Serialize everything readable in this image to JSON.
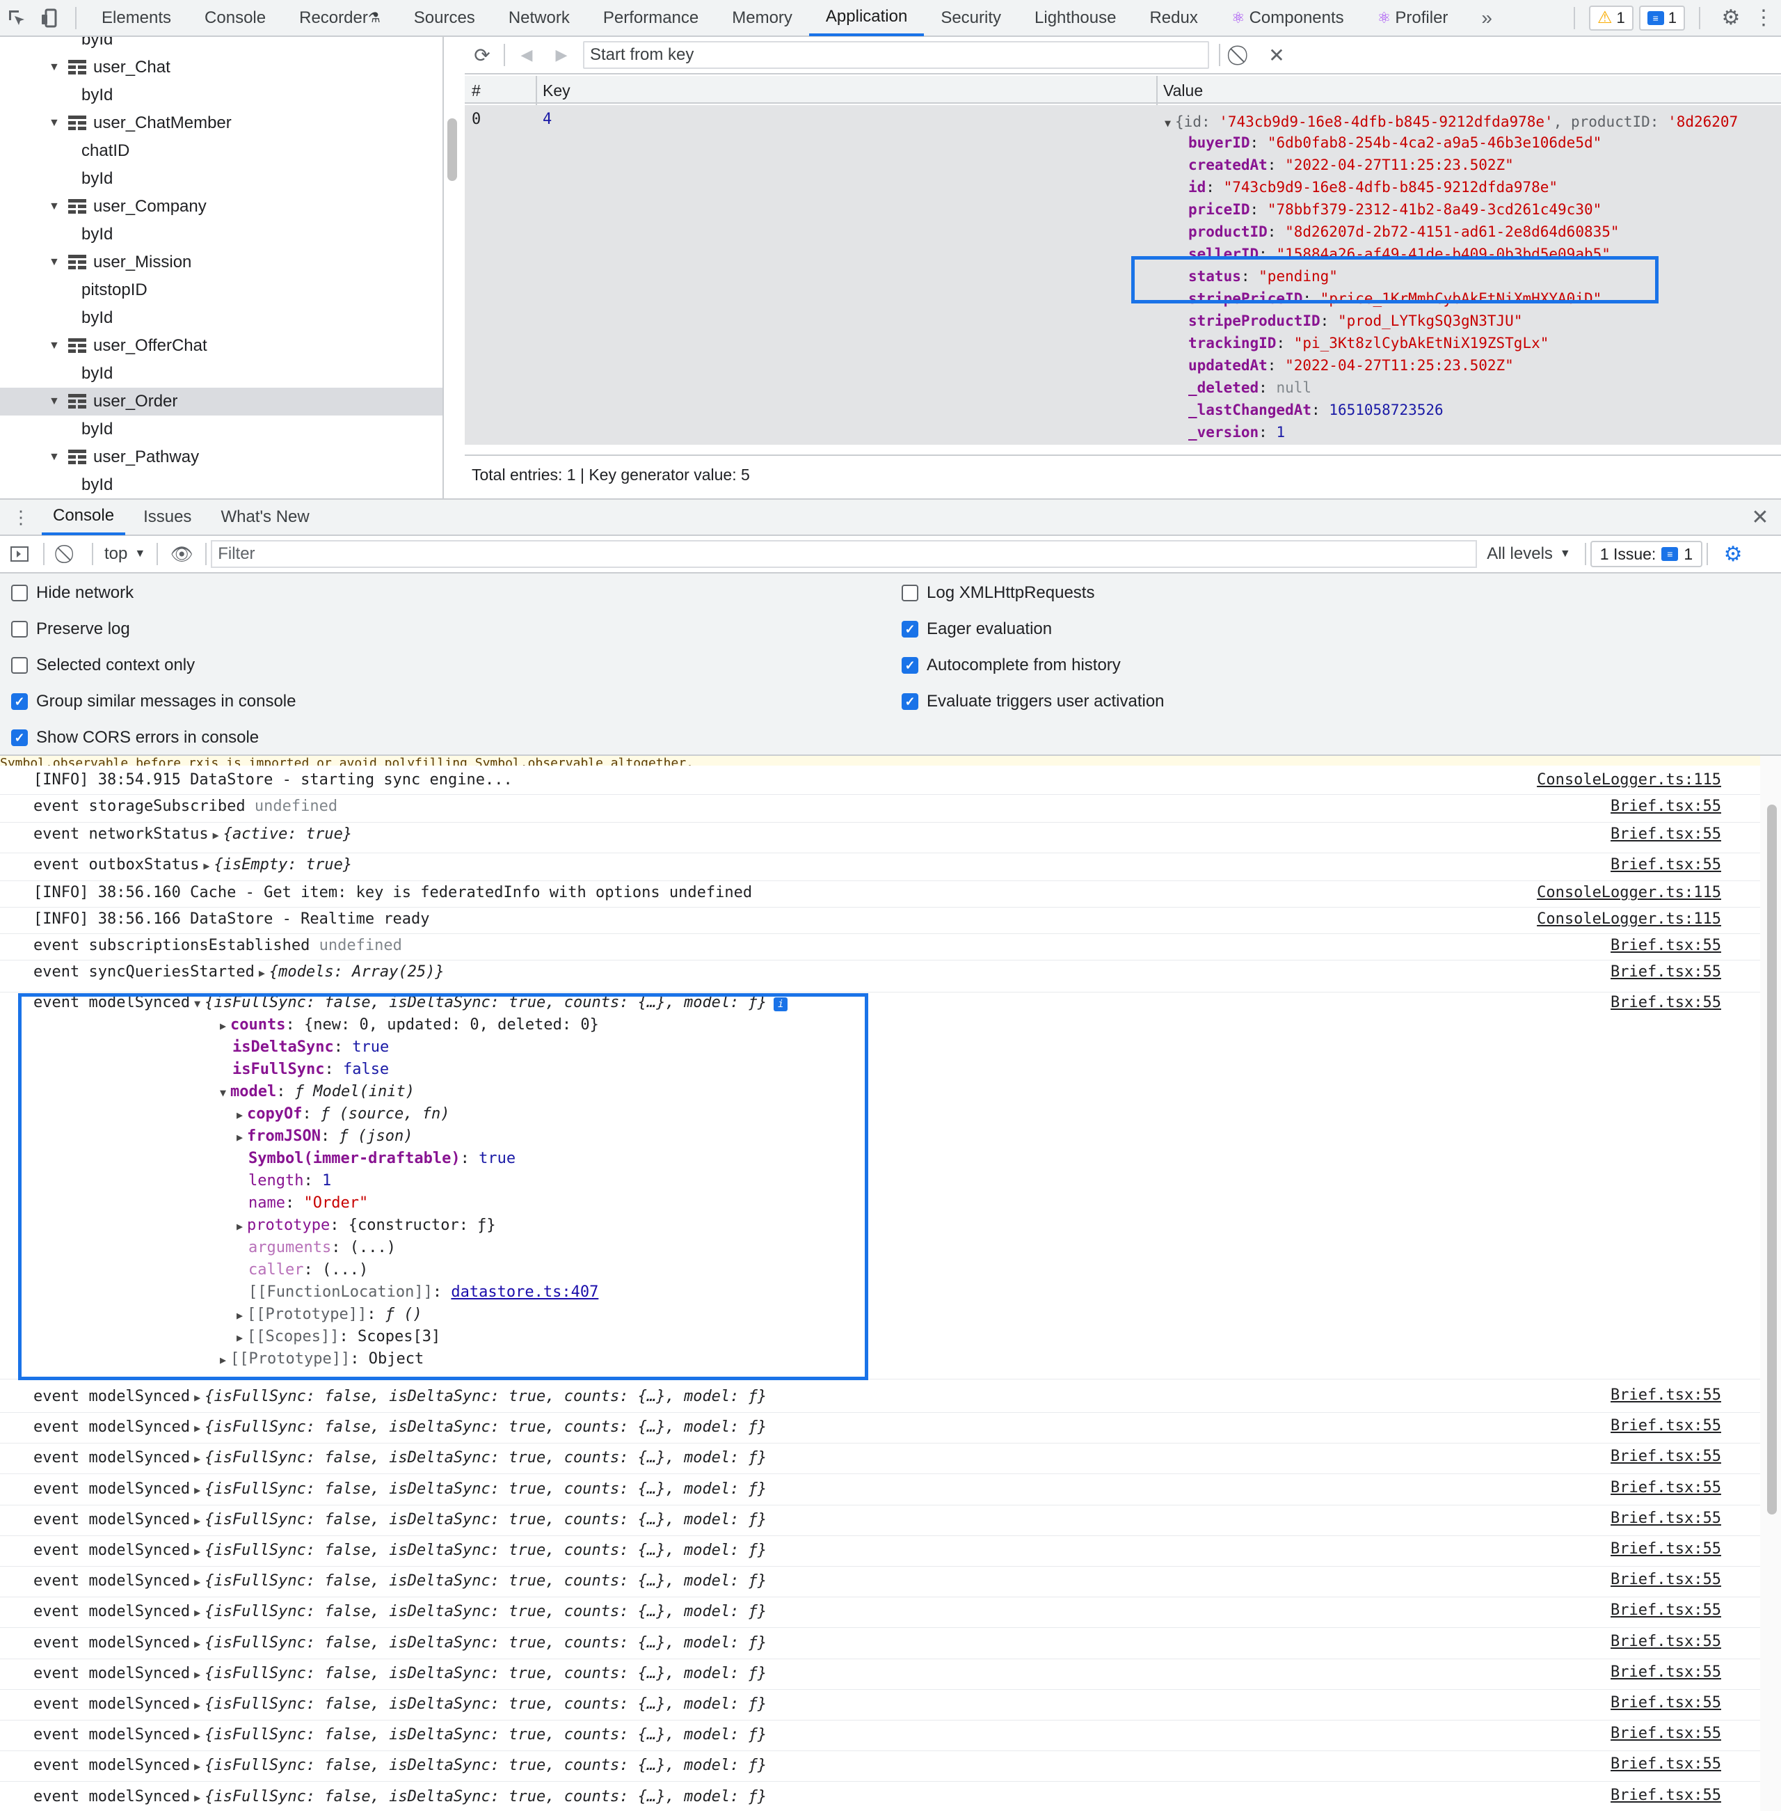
{
  "top_tabs": [
    "Elements",
    "Console",
    "Recorder",
    "Sources",
    "Network",
    "Performance",
    "Memory",
    "Application",
    "Security",
    "Lighthouse",
    "Redux",
    "Components",
    "Profiler"
  ],
  "active_tab": "Application",
  "warnings_count": "1",
  "messages_count": "1",
  "sidebar": {
    "rows": [
      {
        "label": "byId",
        "kind": "index"
      },
      {
        "label": "user_Chat",
        "kind": "store"
      },
      {
        "label": "byId",
        "kind": "index"
      },
      {
        "label": "user_ChatMember",
        "kind": "store"
      },
      {
        "label": "chatID",
        "kind": "index"
      },
      {
        "label": "byId",
        "kind": "index"
      },
      {
        "label": "user_Company",
        "kind": "store"
      },
      {
        "label": "byId",
        "kind": "index"
      },
      {
        "label": "user_Mission",
        "kind": "store"
      },
      {
        "label": "pitstopID",
        "kind": "index"
      },
      {
        "label": "byId",
        "kind": "index"
      },
      {
        "label": "user_OfferChat",
        "kind": "store"
      },
      {
        "label": "byId",
        "kind": "index"
      },
      {
        "label": "user_Order",
        "kind": "store",
        "selected": true
      },
      {
        "label": "byId",
        "kind": "index"
      },
      {
        "label": "user_Pathway",
        "kind": "store"
      },
      {
        "label": "byId",
        "kind": "index"
      }
    ]
  },
  "idb": {
    "key_placeholder": "Start from key",
    "columns": {
      "num": "#",
      "key": "Key",
      "value": "Value"
    },
    "row": {
      "num": "0",
      "key": "4"
    },
    "preview_id": "'743cb9d9-16e8-4dfb-b845-9212dfda978e'",
    "preview_product": "'8d26207",
    "fields": [
      {
        "name": "buyerID",
        "value": "\"6db0fab8-254b-4ca2-a9a5-46b3e106de5d\"",
        "type": "str"
      },
      {
        "name": "createdAt",
        "value": "\"2022-04-27T11:25:23.502Z\"",
        "type": "str"
      },
      {
        "name": "id",
        "value": "\"743cb9d9-16e8-4dfb-b845-9212dfda978e\"",
        "type": "str"
      },
      {
        "name": "priceID",
        "value": "\"78bbf379-2312-41b2-8a49-3cd261c49c30\"",
        "type": "str"
      },
      {
        "name": "productID",
        "value": "\"8d26207d-2b72-4151-ad61-2e8d64d60835\"",
        "type": "str"
      },
      {
        "name": "sellerID",
        "value": "\"15884a26-af49-41de-b409-0b3bd5e09ab5\"",
        "type": "str"
      },
      {
        "name": "status",
        "value": "\"pending\"",
        "type": "str"
      },
      {
        "name": "stripePriceID",
        "value": "\"price_1KrMmhCybAkEtNiXmHXYA0iD\"",
        "type": "str"
      },
      {
        "name": "stripeProductID",
        "value": "\"prod_LYTkgSQ3gN3TJU\"",
        "type": "str"
      },
      {
        "name": "trackingID",
        "value": "\"pi_3Kt8zlCybAkEtNiX19ZSTgLx\"",
        "type": "str"
      },
      {
        "name": "updatedAt",
        "value": "\"2022-04-27T11:25:23.502Z\"",
        "type": "str"
      },
      {
        "name": "_deleted",
        "value": "null",
        "type": "null"
      },
      {
        "name": "_lastChangedAt",
        "value": "1651058723526",
        "type": "num"
      },
      {
        "name": "_version",
        "value": "1",
        "type": "num"
      }
    ],
    "footer": "Total entries: 1 | Key generator value: 5"
  },
  "drawer": {
    "tabs": [
      "Console",
      "Issues",
      "What's New"
    ],
    "active": "Console"
  },
  "console_toolbar": {
    "context": "top",
    "filter_placeholder": "Filter",
    "levels": "All levels",
    "issues_label": "1 Issue:",
    "issues_count": "1"
  },
  "settings_left": [
    {
      "label": "Hide network",
      "checked": false
    },
    {
      "label": "Preserve log",
      "checked": false
    },
    {
      "label": "Selected context only",
      "checked": false
    },
    {
      "label": "Group similar messages in console",
      "checked": true
    },
    {
      "label": "Show CORS errors in console",
      "checked": true
    }
  ],
  "settings_right": [
    {
      "label": "Log XMLHttpRequests",
      "checked": false
    },
    {
      "label": "Eager evaluation",
      "checked": true
    },
    {
      "label": "Autocomplete from history",
      "checked": true
    },
    {
      "label": "Evaluate triggers user activation",
      "checked": true
    }
  ],
  "log": {
    "partial_top": "Symbol.observable before rxjs is imported or avoid polyfilling Symbol.observable altogether.",
    "entries": [
      {
        "text": "[INFO] 38:54.915 DataStore - starting sync engine...",
        "src": "ConsoleLogger.ts:115"
      },
      {
        "text": "event storageSubscribed",
        "extra": "undefined",
        "src": "Brief.tsx:55"
      },
      {
        "text": "event networkStatus",
        "obj": "{active: true}",
        "src": "Brief.tsx:55"
      },
      {
        "text": "event outboxStatus",
        "obj": "{isEmpty: true}",
        "src": "Brief.tsx:55"
      },
      {
        "text": "[INFO] 38:56.160 Cache - Get item: key is federatedInfo with options undefined",
        "src": "ConsoleLogger.ts:115"
      },
      {
        "text": "[INFO] 38:56.166 DataStore - Realtime ready",
        "src": "ConsoleLogger.ts:115"
      },
      {
        "text": "event subscriptionsEstablished",
        "extra": "undefined",
        "src": "Brief.tsx:55"
      },
      {
        "text": "event syncQueriesStarted",
        "obj": "{models: Array(25)}",
        "src": "Brief.tsx:55"
      }
    ],
    "expanded": {
      "prefix": "event modelSynced",
      "summary": "{isFullSync: false, isDeltaSync: true, counts: {…}, model: ƒ}",
      "src": "Brief.tsx:55",
      "counts": "{new: 0, updated: 0, deleted: 0}",
      "isDeltaSync": "true",
      "isFullSync": "false",
      "model": "ƒ Model(init)",
      "copyOf": "ƒ (source, fn)",
      "fromJSON": "ƒ (json)",
      "symbol_key": "Symbol(immer-draftable)",
      "symbol_val": "true",
      "length": "1",
      "name": "\"Order\"",
      "prototype": "{constructor: ƒ}",
      "arguments": "(...)",
      "caller": "(...)",
      "function_location_key": "[[FunctionLocation]]",
      "function_location": "datastore.ts:407",
      "proto_key": "[[Prototype]]",
      "proto_val": "ƒ ()",
      "scopes_key": "[[Scopes]]",
      "scopes_val": "Scopes[3]",
      "outer_proto_key": "[[Prototype]]",
      "outer_proto_val": "Object"
    },
    "collapsed_count": 14,
    "collapsed_prefix": "event modelSynced",
    "collapsed_summary": "{isFullSync: false, isDeltaSync: true, counts: {…}, model: ƒ}",
    "collapsed_src": "Brief.tsx:55"
  }
}
